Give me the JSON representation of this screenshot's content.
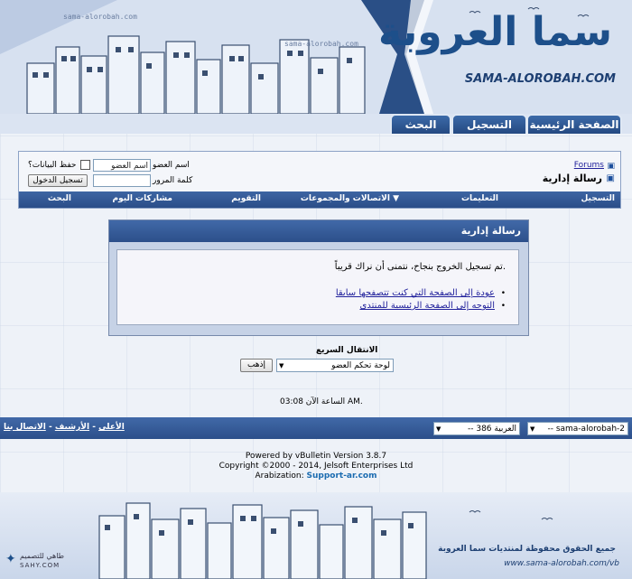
{
  "header": {
    "logo_arabic": "سما العروبة",
    "logo_latin": "SAMA-ALOROBAH.COM",
    "watermark": "sama-alorobah.com",
    "nav_buttons": [
      "الصفحة الرئيسية",
      "التسجيل",
      "البحث"
    ]
  },
  "navbar": {
    "breadcrumb_root": "Forums",
    "page_title": "رسالة إدارية",
    "username_label": "اسم العضو",
    "username_placeholder": "اسم العضو",
    "remember_label": "حفظ البيانات؟",
    "password_label": "كلمة المرور",
    "login_button": "تسجيل الدخول",
    "links": [
      "التسجيل",
      "التعليمات",
      "الاتصالات والمجموعات",
      "التقويم",
      "مشاركات اليوم",
      "البحث"
    ]
  },
  "message": {
    "title": "رسالة إدارية",
    "text": "تم تسجيل الخروج بنجاح، نتمنى أن نراك قريباً.",
    "links": [
      "عودة إلى الصفحة التي كنت تتصفحها سابقا",
      "التوجه إلى الصفحة الرئيسية للمنتدى"
    ]
  },
  "quick_nav": {
    "title": "الانتقال السريع",
    "selected": "لوحة تحكم العضو",
    "go_button": "إذهب"
  },
  "time_text": "الساعة الآن 03:08 AM.",
  "footer": {
    "style_select": "-- sama-alorobah-2",
    "lang_select": "-- العربية 386",
    "links": [
      "الاتصال بنا",
      "الأرشيف",
      "الأعلى"
    ],
    "separator": "-"
  },
  "credits": {
    "line1": "Powered by vBulletin Version 3.8.7",
    "line2": "Copyright ©2000 - 2014, Jelsoft Enterprises Ltd",
    "line3_label": "Arabization:",
    "line3_link": "Support-ar.com"
  },
  "bottom": {
    "rights": "جميع الحقوق محفوظة لمنتديات سما العروبة",
    "url": "www.sama-alorobah.com/vb",
    "designer_label": "طاهي للتصميم",
    "designer_site": "SAHY.COM"
  },
  "colors": {
    "brand_dark": "#22467e",
    "brand": "#3c6aa8",
    "link": "#22229c"
  }
}
